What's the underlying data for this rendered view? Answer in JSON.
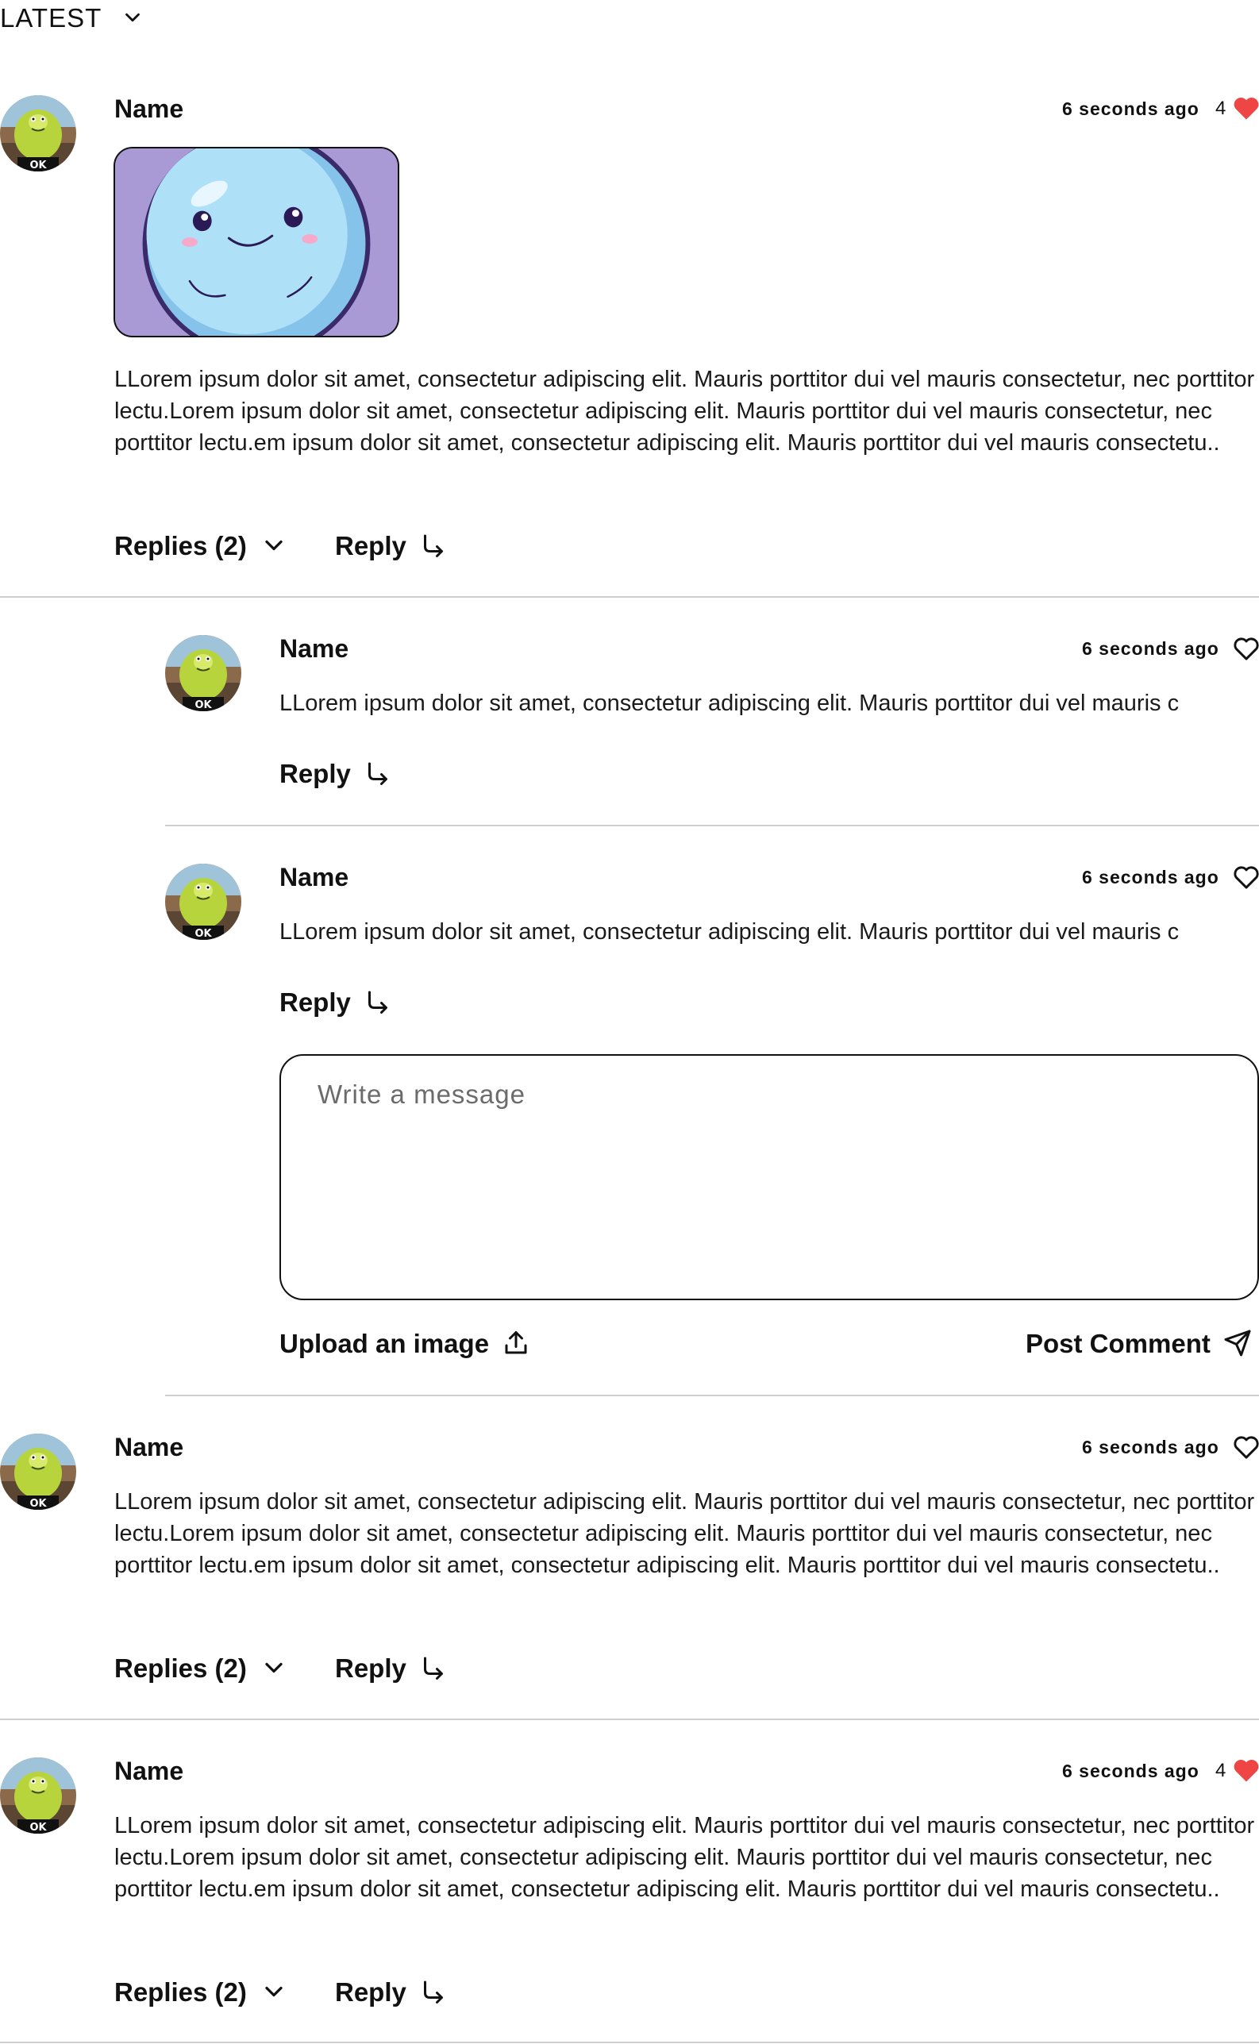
{
  "sort": {
    "label": "LATEST",
    "icon": "chevron-down-icon"
  },
  "colors": {
    "like_active": "#f04545",
    "divider": "#cfcfcf",
    "text": "#111111"
  },
  "comments": [
    {
      "author": "Name",
      "time": "6 seconds ago",
      "likes": "4",
      "liked": true,
      "has_image": true,
      "text": "LLorem ipsum dolor sit amet, consectetur adipiscing elit. Mauris porttitor dui vel mauris consectetur, nec porttitor lectu.Lorem ipsum dolor sit amet, consectetur adipiscing elit. Mauris porttitor dui vel mauris consectetur, nec porttitor lectu.em ipsum dolor sit amet, consectetur adipiscing elit. Mauris porttitor dui vel mauris consectetu..",
      "replies_label": "Replies (2)",
      "reply_label": "Reply"
    },
    {
      "author": "Name",
      "time": "6 seconds ago",
      "liked": false,
      "text": "LLorem ipsum dolor sit amet, consectetur adipiscing elit. Mauris porttitor dui vel mauris consectetur, nec porttitor lectu.Lorem ipsum dolor sit amet, consectetur adipiscing elit. Mauris porttitor dui vel mauris consectetur, nec porttitor lectu.em ipsum dolor sit amet, consectetur adipiscing elit. Mauris porttitor dui vel mauris consectetu..",
      "replies_label": "Replies (2)",
      "reply_label": "Reply"
    },
    {
      "author": "Name",
      "time": "6 seconds ago",
      "likes": "4",
      "liked": true,
      "text": "LLorem ipsum dolor sit amet, consectetur adipiscing elit. Mauris porttitor dui vel mauris consectetur, nec porttitor lectu.Lorem ipsum dolor sit amet, consectetur adipiscing elit. Mauris porttitor dui vel mauris consectetur, nec porttitor lectu.em ipsum dolor sit amet, consectetur adipiscing elit. Mauris porttitor dui vel mauris consectetu..",
      "replies_label": "Replies (2)",
      "reply_label": "Reply"
    }
  ],
  "replies": [
    {
      "author": "Name",
      "time": "6 seconds ago",
      "liked": false,
      "text": "LLorem ipsum dolor sit amet, consectetur adipiscing elit. Mauris porttitor dui vel mauris c",
      "reply_label": "Reply"
    },
    {
      "author": "Name",
      "time": "6 seconds ago",
      "liked": false,
      "text": "LLorem ipsum dolor sit amet, consectetur adipiscing elit. Mauris porttitor dui vel mauris c",
      "reply_label": "Reply"
    }
  ],
  "composer": {
    "placeholder": "Write a message",
    "value": "",
    "upload_label": "Upload an image",
    "post_label": "Post Comment"
  }
}
